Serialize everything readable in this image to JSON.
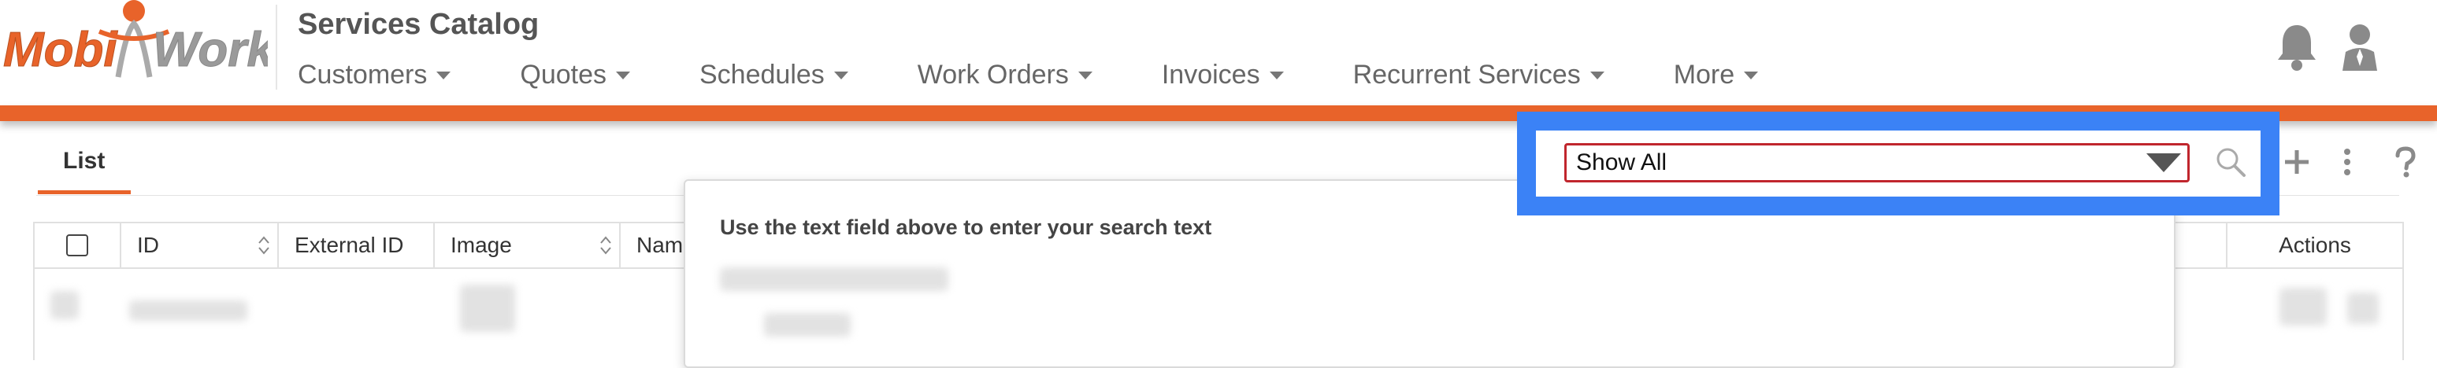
{
  "header": {
    "logo": {
      "text_left": "Mobi",
      "text_right": "Work"
    },
    "title": "Services Catalog",
    "nav": [
      {
        "label": "Customers"
      },
      {
        "label": "Quotes"
      },
      {
        "label": "Schedules"
      },
      {
        "label": "Work Orders"
      },
      {
        "label": "Invoices"
      },
      {
        "label": "Recurrent Services"
      },
      {
        "label": "More"
      }
    ],
    "icons": {
      "notifications": "bell-icon",
      "user": "user-icon"
    }
  },
  "colors": {
    "brand_orange": "#e8632a",
    "highlight_blue": "#3b82f6",
    "select_border": "#c0262d"
  },
  "toolbar": {
    "tab_label": "List",
    "filter_value": "Show All",
    "icons": [
      "search-icon",
      "plus-icon",
      "more-vertical-icon",
      "help-icon"
    ]
  },
  "table": {
    "columns": [
      "ID",
      "External ID",
      "Image",
      "Name",
      "Actions"
    ]
  },
  "dropdown": {
    "hint": "Use the text field above to enter your search text"
  }
}
